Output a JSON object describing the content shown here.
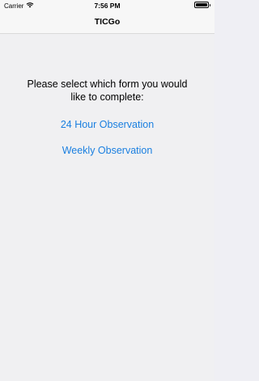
{
  "status_bar": {
    "carrier": "Carrier",
    "time": "7:56 PM",
    "battery_level": 1.0
  },
  "nav": {
    "title": "TICGo"
  },
  "main": {
    "prompt": "Please select which form you would like to complete:",
    "options": [
      {
        "label": "24 Hour Observation"
      },
      {
        "label": "Weekly Observation"
      }
    ]
  },
  "colors": {
    "link": "#1a7fe0",
    "background": "#f0f0f2",
    "bar": "#f7f7f7"
  },
  "icons": [
    "wifi-icon",
    "battery-icon"
  ]
}
